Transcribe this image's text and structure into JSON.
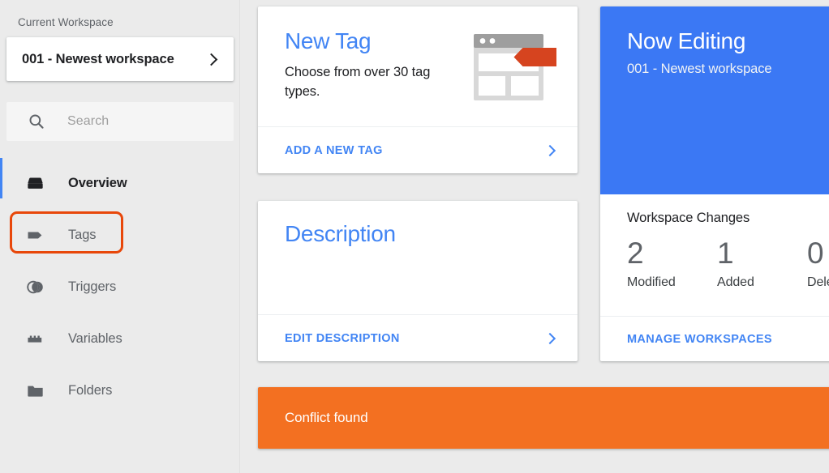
{
  "sidebar": {
    "workspace_label": "Current Workspace",
    "workspace_name": "001 - Newest workspace",
    "search": {
      "placeholder": "Search",
      "value": ""
    },
    "items": [
      {
        "label": "Overview",
        "icon": "overview-icon",
        "active": true
      },
      {
        "label": "Tags",
        "icon": "tag-icon",
        "active": false
      },
      {
        "label": "Triggers",
        "icon": "trigger-icon",
        "active": false
      },
      {
        "label": "Variables",
        "icon": "variables-icon",
        "active": false
      },
      {
        "label": "Folders",
        "icon": "folder-icon",
        "active": false
      }
    ],
    "annotation": {
      "target": "Tags",
      "color": "#e8470a"
    }
  },
  "cards": {
    "new_tag": {
      "title": "New Tag",
      "subtitle": "Choose from over 30 tag types.",
      "action_label": "ADD A NEW TAG",
      "illustration": "browser-tag-illustration"
    },
    "description": {
      "title": "Description",
      "body": "",
      "action_label": "EDIT DESCRIPTION"
    },
    "now_editing": {
      "title": "Now Editing",
      "workspace": "001 - Newest workspace",
      "changes_title": "Workspace Changes",
      "stats": [
        {
          "value": "2",
          "label": "Modified"
        },
        {
          "value": "1",
          "label": "Added"
        },
        {
          "value": "0",
          "label": "Deleted"
        }
      ],
      "action_label": "MANAGE WORKSPACES"
    }
  },
  "conflict_banner": {
    "text": "Conflict found"
  },
  "colors": {
    "accent_blue": "#4285f4",
    "card_blue": "#3b78f4",
    "warning_orange": "#f37021",
    "annotation_orange": "#e8470a",
    "background": "#ebebeb"
  }
}
